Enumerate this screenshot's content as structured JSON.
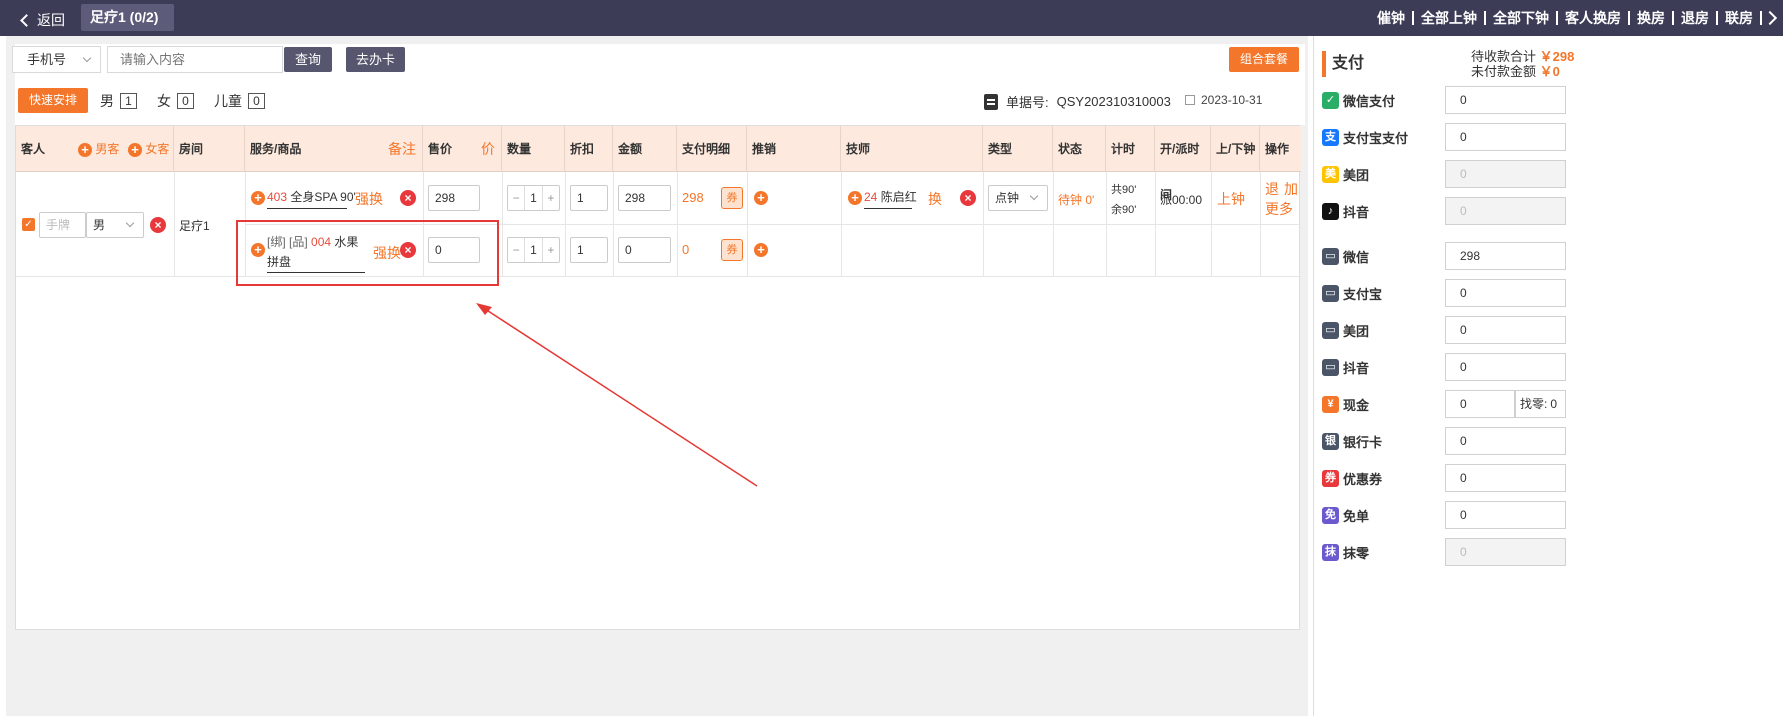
{
  "topbar": {
    "back_label": "返回",
    "room_tab": "足疗1 (0/2)",
    "menu": [
      "催钟",
      "全部上钟",
      "全部下钟",
      "客人换房",
      "换房",
      "退房",
      "联房"
    ]
  },
  "search": {
    "select_value": "手机号",
    "placeholder": "请输入内容",
    "query_label": "查询",
    "card_label": "去办卡",
    "package_label": "组合套餐"
  },
  "quick": {
    "arrange_label": "快速安排",
    "male_label": "男",
    "male_count": "1",
    "female_label": "女",
    "female_count": "0",
    "child_label": "儿童",
    "child_count": "0"
  },
  "order": {
    "order_label": "单据号:",
    "order_no": "QSY202310310003",
    "date": "2023-10-31"
  },
  "table": {
    "headers": {
      "guest": "客人",
      "male_guest": "男客",
      "female_guest": "女客",
      "room": "房间",
      "service": "服务/商品",
      "note": "备注",
      "price": "售价",
      "price_short": "价",
      "qty": "数量",
      "discount": "折扣",
      "amount": "金额",
      "paydetail": "支付明细",
      "promo": "推销",
      "tech": "技师",
      "type": "类型",
      "status": "状态",
      "timer": "计时",
      "open_time": "开/派时间",
      "clock": "上/下钟",
      "ops": "操作"
    },
    "guest": {
      "tag_placeholder": "手牌",
      "gender": "男",
      "room": "足疗1"
    },
    "row1": {
      "code": "403",
      "name": "全身SPA 90'",
      "force_change": "强换",
      "price": "298",
      "qty": "1",
      "discount": "1",
      "amount": "298",
      "pay": "298",
      "coupon": "券",
      "tech_no": "24",
      "tech_name": "陈启红",
      "tech_change": "换",
      "type": "点钟",
      "status": "待钟 0'",
      "timer_total": "共90'",
      "timer_left": "余90'",
      "open_time": "派00:00",
      "clock": "上钟",
      "op_return": "退",
      "op_add": "加",
      "op_more": "更多"
    },
    "row2": {
      "tags": "[绑] [品]",
      "code": "004",
      "name": "水果拼盘",
      "force_change": "强换",
      "price": "0",
      "qty": "1",
      "discount": "1",
      "amount": "0",
      "pay": "0",
      "coupon": "券"
    }
  },
  "payment": {
    "title": "支付",
    "pending_label": "待收款合计",
    "pending_value": "￥298",
    "unpaid_label": "未付款金额",
    "unpaid_value": "￥0",
    "methods": [
      {
        "label": "微信支付",
        "value": "0",
        "disabled": false,
        "icon": "wechat-pay-icon",
        "color": "#2aae67"
      },
      {
        "label": "支付宝支付",
        "value": "0",
        "disabled": false,
        "icon": "alipay-icon",
        "color": "#1677ff"
      },
      {
        "label": "美团",
        "value": "0",
        "disabled": true,
        "icon": "meituan-icon",
        "color": "#ffc300"
      },
      {
        "label": "抖音",
        "value": "0",
        "disabled": true,
        "icon": "douyin-icon",
        "color": "#111111"
      },
      {
        "label": "微信",
        "value": "298",
        "disabled": false,
        "icon": "wallet-icon",
        "color": "#4a5568"
      },
      {
        "label": "支付宝",
        "value": "0",
        "disabled": false,
        "icon": "wallet-icon",
        "color": "#4a5568"
      },
      {
        "label": "美团",
        "value": "0",
        "disabled": false,
        "icon": "wallet-icon",
        "color": "#4a5568"
      },
      {
        "label": "抖音",
        "value": "0",
        "disabled": false,
        "icon": "wallet-icon",
        "color": "#4a5568"
      },
      {
        "label": "现金",
        "value": "0",
        "disabled": false,
        "icon": "cash-icon",
        "color": "#f3762a"
      },
      {
        "label": "银行卡",
        "value": "0",
        "disabled": false,
        "icon": "bankcard-icon",
        "color": "#4a5568"
      },
      {
        "label": "优惠券",
        "value": "0",
        "disabled": false,
        "icon": "coupon-icon",
        "color": "#e8383b"
      },
      {
        "label": "免单",
        "value": "0",
        "disabled": false,
        "icon": "free-icon",
        "color": "#6a5acd"
      },
      {
        "label": "抹零",
        "value": "0",
        "disabled": true,
        "icon": "round-off-icon",
        "color": "#6a5acd"
      }
    ],
    "change_label": "找零:",
    "change_value": "0"
  },
  "colors": {
    "accent": "#f3762a",
    "topbar": "#3c3c57",
    "danger": "#e8383b",
    "annotation": "#e53935"
  }
}
